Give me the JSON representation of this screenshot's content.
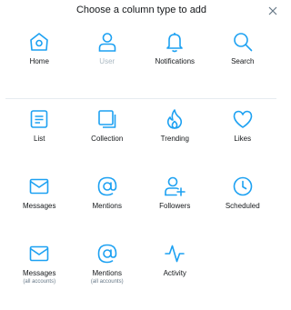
{
  "header": {
    "title": "Choose a column type to add",
    "close_icon": "close-icon"
  },
  "accent_color": "#1da1f2",
  "columns": {
    "home": {
      "label": "Home",
      "icon": "home-icon"
    },
    "user": {
      "label": "User",
      "icon": "user-icon",
      "disabled": true
    },
    "notifications": {
      "label": "Notifications",
      "icon": "bell-icon"
    },
    "search": {
      "label": "Search",
      "icon": "search-icon"
    },
    "list": {
      "label": "List",
      "icon": "list-icon"
    },
    "collection": {
      "label": "Collection",
      "icon": "collection-icon"
    },
    "trending": {
      "label": "Trending",
      "icon": "flame-icon"
    },
    "likes": {
      "label": "Likes",
      "icon": "heart-icon"
    },
    "messages": {
      "label": "Messages",
      "icon": "envelope-icon"
    },
    "mentions": {
      "label": "Mentions",
      "icon": "at-icon"
    },
    "followers": {
      "label": "Followers",
      "icon": "add-user-icon"
    },
    "scheduled": {
      "label": "Scheduled",
      "icon": "clock-icon"
    },
    "messages_all": {
      "label": "Messages",
      "sublabel": "(all accounts)",
      "icon": "envelope-icon"
    },
    "mentions_all": {
      "label": "Mentions",
      "sublabel": "(all accounts)",
      "icon": "at-icon"
    },
    "activity": {
      "label": "Activity",
      "icon": "activity-icon"
    }
  }
}
